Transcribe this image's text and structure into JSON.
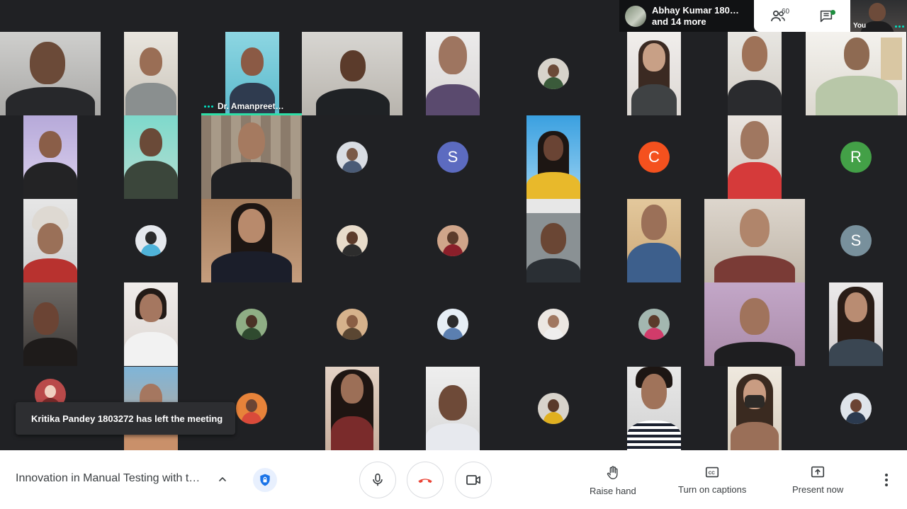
{
  "header": {
    "presenter_name": "Abhay Kumar 180…",
    "presenter_more": "and 14 more",
    "people_count": "60",
    "self_label": "You"
  },
  "participants": {
    "speaker_name": "Dr. Amanpreet…",
    "initials": {
      "s1": "S",
      "c": "C",
      "r": "R",
      "s2": "S"
    }
  },
  "notification": {
    "text": "Kritika Pandey 1803272 has left the meeting"
  },
  "footer": {
    "meeting_title": "Innovation in Manual Testing with t…",
    "raise_hand": "Raise hand",
    "captions": "Turn on captions",
    "present": "Present now"
  },
  "colors": {
    "background": "#202124",
    "accent_teal": "#00e3c3",
    "hangup_red": "#ea4335",
    "avatar_s1": "#5c6bc0",
    "avatar_c": "#f4511e",
    "avatar_r": "#43a047",
    "avatar_s2": "#78909c"
  }
}
